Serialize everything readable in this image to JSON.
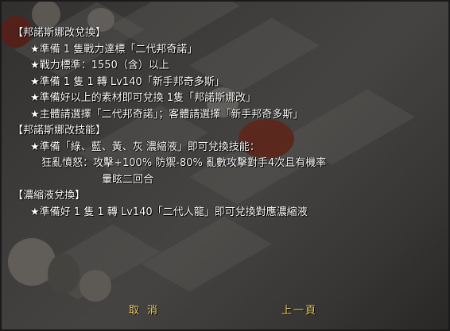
{
  "dialog": {
    "lines": [
      "【邦諾斯娜改兌換】",
      "★準備 1 隻戰力達標「二代邦奇諾」",
      "★戰力標準：1550（含）以上",
      "★準備 1 隻 1 轉 Lv140「新手邦奇多斯」",
      "★準備好以上的素材即可兌換 1隻「邦諾斯娜改」",
      "★主體請選擇「二代邦奇諾」；客體請選擇「新手邦奇多斯」",
      "【邦諾斯娜改技能】",
      "★準備「綠、藍、黃、灰 濃縮液」即可兌換技能：",
      "狂亂憤怒：攻擊+100% 防禦-80% 亂數攻擊對手4次且有機率",
      "暈眩二回合",
      "【濃縮液兌換】",
      "★準備好 1 隻 1 轉 Lv140「二代人龍」即可兌換對應濃縮液"
    ]
  },
  "footer": {
    "cancel_label": "取消",
    "prev_label": "上一頁"
  },
  "colors": {
    "text": "#ffffff",
    "button_text": "#f0d060",
    "overlay": "#000000"
  }
}
